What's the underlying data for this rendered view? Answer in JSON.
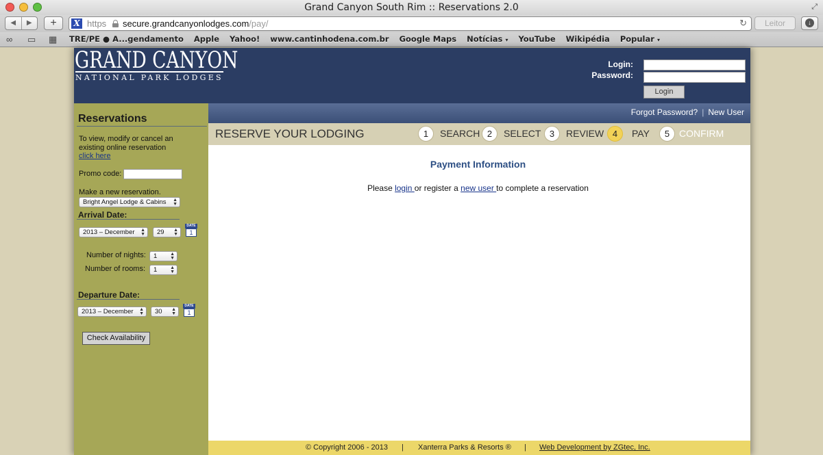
{
  "browser": {
    "window_title": "Grand Canyon South Rim :: Reservations 2.0",
    "nav_back": "◀",
    "nav_forward": "▶",
    "add_tab": "+",
    "site_icon_letter": "X",
    "scheme": "https",
    "url_host": "secure.grandcanyonlodges.com",
    "url_path": "/pay/",
    "reload_icon": "↻",
    "reader_label": "Leitor",
    "bookmarks": [
      "TRE/PE ● A...gendamento",
      "Apple",
      "Yahoo!",
      "www.cantinhodena.com.br",
      "Google Maps",
      "Notícias",
      "YouTube",
      "Wikipédia",
      "Popular"
    ],
    "bookmark_caret": "▾"
  },
  "header": {
    "logo_main": "GRAND CANYON",
    "logo_sub": "NATIONAL PARK LODGES",
    "login_label": "Login:",
    "password_label": "Password:",
    "login_button": "Login"
  },
  "sidebar": {
    "title": "Reservations",
    "view_text": "To view, modify or cancel an existing online reservation",
    "click_here": "click here",
    "promo_label": "Promo code:",
    "new_res_label": "Make a new reservation.",
    "lodge_select": "Bright Angel Lodge & Cabins",
    "arrival_heading": "Arrival Date:",
    "arrival_month": "2013 – December",
    "arrival_day": "29",
    "nights_label": "Number of nights:",
    "nights_value": "1",
    "rooms_label": "Number of rooms:",
    "rooms_value": "1",
    "departure_heading": "Departure Date:",
    "departure_month": "2013 – December",
    "departure_day": "30",
    "calendar_top": "DATE",
    "calendar_num": "1",
    "check_button": "Check Availability"
  },
  "topnav": {
    "forgot": "Forgot Password?",
    "separator": "|",
    "new_user": "New User"
  },
  "steps": {
    "title": "RESERVE YOUR LODGING",
    "items": [
      {
        "num": "1",
        "label": "SEARCH"
      },
      {
        "num": "2",
        "label": "SELECT"
      },
      {
        "num": "3",
        "label": "REVIEW"
      },
      {
        "num": "4",
        "label": "PAY"
      },
      {
        "num": "5",
        "label": "CONFIRM"
      }
    ],
    "active_step": "4"
  },
  "content": {
    "heading": "Payment Information",
    "msg_pre": "Please ",
    "msg_login": "login ",
    "msg_mid": "or register a ",
    "msg_newuser": "new user ",
    "msg_post": "to complete a reservation"
  },
  "footer": {
    "copyright": "© Copyright 2006 - 2013",
    "separator": "|",
    "company": "Xanterra Parks & Resorts ®",
    "webdev": "Web Development by ZGtec, Inc."
  },
  "colors": {
    "header_bg": "#2b3d63",
    "sidebar_bg": "#a6a757",
    "steps_bg": "#d6d0b4",
    "active_step": "#f2d257",
    "footer_bg": "#ecd769",
    "link": "#17338a"
  }
}
